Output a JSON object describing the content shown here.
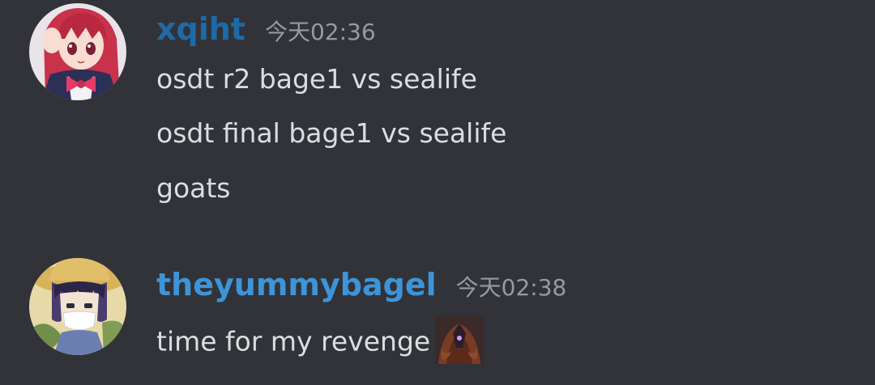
{
  "messages": [
    {
      "author": "xqiht",
      "timestamp": "今天02:36",
      "name_color": "#1e6aa6",
      "avatar_icon": "anime-girl-red-hair-avatar",
      "lines": [
        "osdt r2 bage1 vs sealife",
        "osdt final bage1 vs sealife",
        "goats"
      ]
    },
    {
      "author": "theyummybagel",
      "timestamp": "今天02:38",
      "name_color": "#3d94d8",
      "avatar_icon": "anime-boy-straw-hat-avatar",
      "lines": [
        "time for my revenge"
      ],
      "emoji_icon": "hooded-villain-emoji"
    }
  ],
  "colors": {
    "background": "#313338",
    "text": "#dbdee1",
    "timestamp": "#949ba4"
  }
}
